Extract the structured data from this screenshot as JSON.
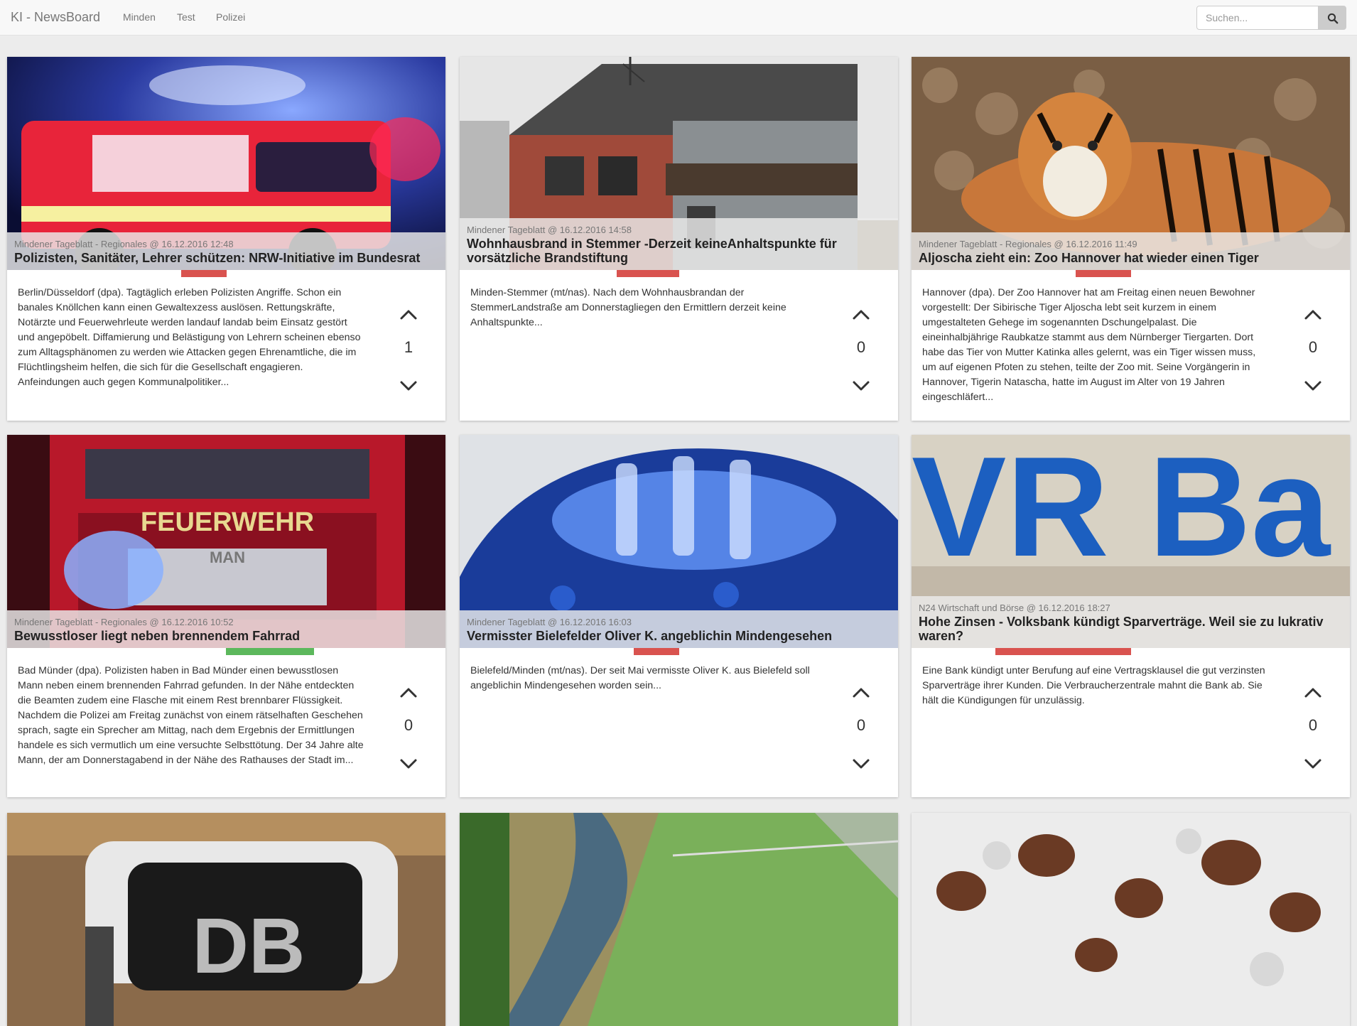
{
  "navbar": {
    "brand": "KI - NewsBoard",
    "links": [
      "Minden",
      "Test",
      "Polizei"
    ],
    "search_placeholder": "Suchen..."
  },
  "colors": {
    "bar_negative": "#d9534f",
    "bar_positive": "#5cb85c"
  },
  "cards": [
    {
      "meta": "Mindener Tageblatt - Regionales @ 16.12.2016 12:48",
      "title": "Polizisten, Sanitäter, Lehrer schützen: NRW-Initiative im Bundesrat",
      "text": "Berlin/Düsseldorf (dpa). Tagtäglich erleben Polizisten Angriffe. Schon ein banales Knöllchen kann einen Gewaltexzess auslösen. Rettungskräfte, Notärzte und Feuerwehrleute werden landauf landab beim Einsatz gestört und angepöbelt. Diffamierung und Belästigung von Lehrern scheinen ebenso zum Alltagsphänomen zu werden wie Attacken gegen Ehrenamtliche, die im Flüchtlingsheim helfen, die sich für die Gesellschaft engagieren. Anfeindungen auch gegen Kommunalpolitiker...",
      "votes": "1",
      "image": "ambulance"
    },
    {
      "meta": "Mindener Tageblatt @ 16.12.2016 14:58",
      "title": "Wohnhausbrand in Stemmer -Derzeit keineAnhaltspunkte für vorsätzliche Brandstiftung",
      "text": "Minden-Stemmer (mt/nas). Nach dem Wohnhausbrandan der StemmerLandstraße am Donnerstagliegen den Ermittlern derzeit keine Anhaltspunkte...",
      "votes": "0",
      "image": "house"
    },
    {
      "meta": "Mindener Tageblatt - Regionales @ 16.12.2016 11:49",
      "title": "Aljoscha zieht ein: Zoo Hannover hat wieder einen Tiger",
      "text": "Hannover (dpa). Der Zoo Hannover hat am Freitag einen neuen Bewohner vorgestellt: Der Sibirische Tiger Aljoscha lebt seit kurzem in einem umgestalteten Gehege im sogenannten Dschungelpalast. Die eineinhalbjährige Raubkatze stammt aus dem Nürnberger Tiergarten. Dort habe das Tier von Mutter Katinka alles gelernt, was ein Tiger wissen muss, um auf eigenen Pfoten zu stehen, teilte der Zoo mit. Seine Vorgängerin in Hannover, Tigerin Natascha, hatte im August im Alter von 19 Jahren eingeschläfert...",
      "votes": "0",
      "image": "tiger"
    },
    {
      "meta": "Mindener Tageblatt - Regionales @ 16.12.2016 10:52",
      "title": "Bewusstloser liegt neben brennendem Fahrrad",
      "text": "Bad Münder (dpa). Polizisten haben in Bad Münder einen bewusstlosen Mann neben einem brennenden Fahrrad gefunden. In der Nähe entdeckten die Beamten zudem eine Flasche mit einem Rest brennbarer Flüssigkeit. Nachdem die Polizei am Freitag zunächst von einem rätselhaften Geschehen sprach, sagte ein Sprecher am Mittag, nach dem Ergebnis der Ermittlungen handele es sich vermutlich um eine versuchte Selbsttötung. Der 34 Jahre alte Mann, der am Donnerstagabend in der Nähe des Rathauses der Stadt im...",
      "votes": "0",
      "image": "firetruck",
      "image_text": "FEUERWEHR"
    },
    {
      "meta": "Mindener Tageblatt @ 16.12.2016 16:03",
      "title": "Vermisster Bielefelder Oliver K. angeblichin Mindengesehen",
      "text": "Bielefeld/Minden (mt/nas). Der seit Mai vermisste Oliver K. aus Bielefeld soll angeblichin Mindengesehen worden sein...",
      "votes": "0",
      "image": "bluelight"
    },
    {
      "meta": "N24 Wirtschaft und Börse @ 16.12.2016 18:27",
      "title": "Hohe Zinsen -  Volksbank kündigt Sparverträge. Weil sie zu lukrativ waren?",
      "text": "Eine Bank kündigt unter Berufung auf eine Vertragsklausel die gut verzinsten Sparverträge ihrer Kunden. Die Verbraucherzentrale mahnt die Bank ab. Sie hält die Kündigungen für unzulässig.",
      "votes": "0",
      "image": "vrbank",
      "image_text": "VR Ba"
    },
    {
      "image": "db",
      "image_text": "DB"
    },
    {
      "image": "river"
    },
    {
      "image": "snow"
    }
  ]
}
